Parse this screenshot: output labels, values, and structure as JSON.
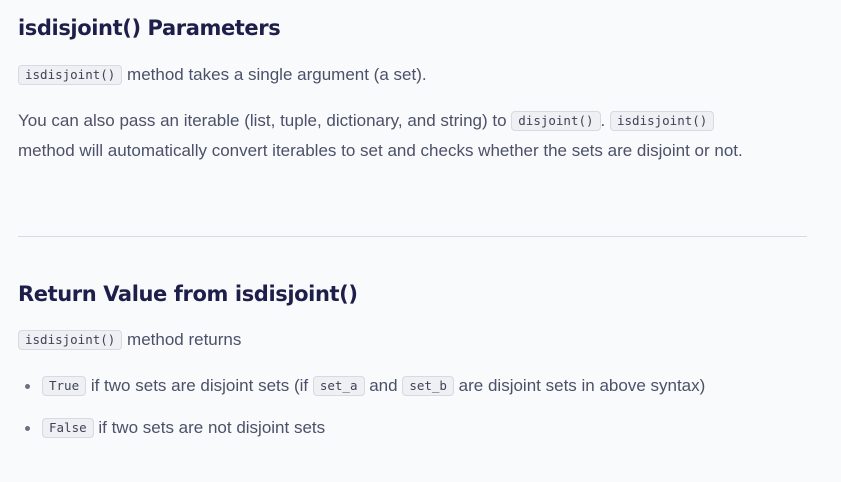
{
  "section1": {
    "heading": "isdisjoint() Parameters",
    "p1_code": "isdisjoint()",
    "p1_text": " method takes a single argument (a set).",
    "p2_text_a": "You can also pass an iterable (list, tuple, dictionary, and string) to ",
    "p2_code_a": "disjoint()",
    "p2_text_b": ". ",
    "p2_code_b": "isdisjoint()",
    "p2_text_c": "method will automatically convert iterables to set and checks whether the sets are disjoint or not."
  },
  "section2": {
    "heading": "Return Value from isdisjoint()",
    "p1_code": "isdisjoint()",
    "p1_text": " method returns",
    "bullets": [
      {
        "code": "True",
        "text_a": " if two sets are disjoint sets (if ",
        "code_a": "set_a",
        "text_b": " and ",
        "code_b": "set_b",
        "text_c": " are disjoint sets in above syntax)"
      },
      {
        "code": "False",
        "text_a": " if two sets are not disjoint sets"
      }
    ]
  }
}
